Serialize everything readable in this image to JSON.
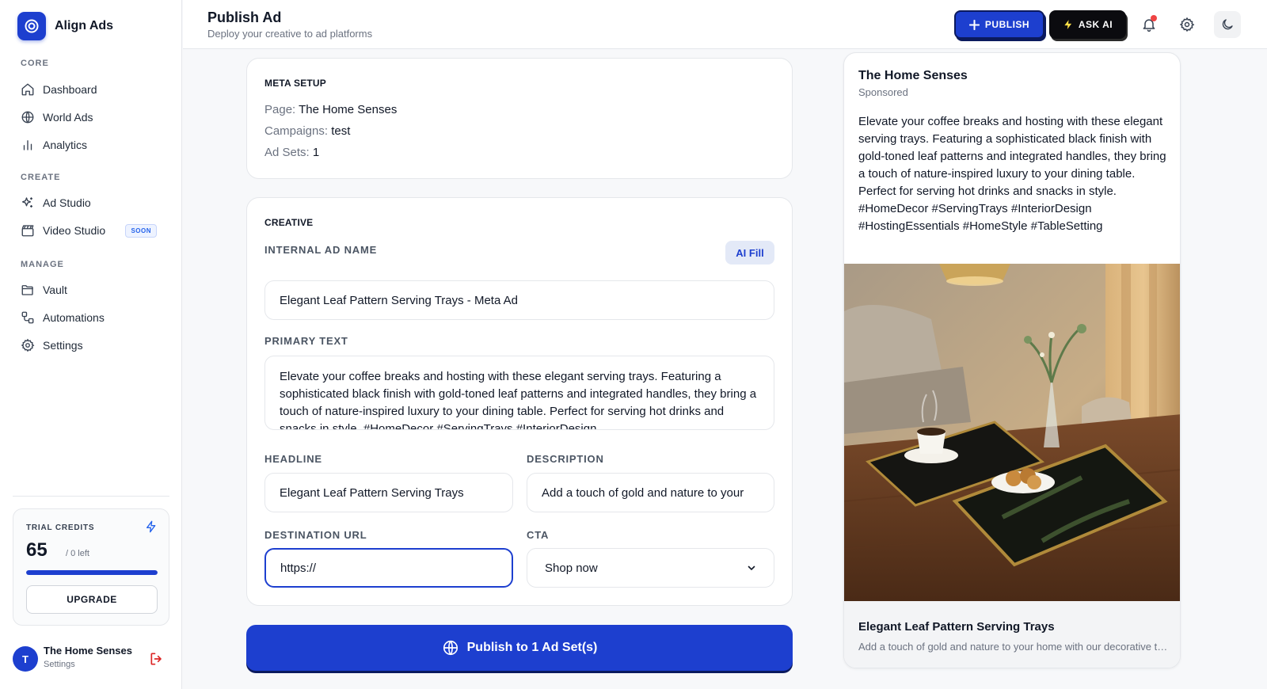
{
  "brand": {
    "name": "Align Ads"
  },
  "sidebar": {
    "sections": [
      {
        "label": "CORE"
      },
      {
        "label": "CREATE"
      },
      {
        "label": "MANAGE"
      }
    ],
    "items": [
      {
        "label": "Dashboard",
        "icon": "home-icon"
      },
      {
        "label": "World Ads",
        "icon": "globe-icon"
      },
      {
        "label": "Analytics",
        "icon": "bar-chart-icon"
      },
      {
        "label": "Ad Studio",
        "icon": "sparkles-icon"
      },
      {
        "label": "Video Studio",
        "icon": "clapperboard-icon",
        "badge": "SOON"
      },
      {
        "label": "Vault",
        "icon": "folder-icon"
      },
      {
        "label": "Automations",
        "icon": "workflow-icon"
      },
      {
        "label": "Settings",
        "icon": "gear-icon"
      }
    ]
  },
  "credits": {
    "label": "TRIAL CREDITS",
    "value": "65",
    "suffix": "/ 0 left",
    "progress": 1.0,
    "upgrade_label": "UPGRADE"
  },
  "user": {
    "initial": "T",
    "name": "The Home Senses",
    "sub": "Settings"
  },
  "header": {
    "title": "Publish Ad",
    "subtitle": "Deploy your creative to ad platforms",
    "publish_label": "PUBLISH",
    "ask_ai_label": "ASK AI"
  },
  "meta_setup": {
    "title": "META SETUP",
    "page_label": "Page:",
    "page_value": "The Home Senses",
    "campaigns_label": "Campaigns:",
    "campaigns_value": "test",
    "adsets_label": "Ad Sets:",
    "adsets_value": "1"
  },
  "creative": {
    "title": "CREATIVE",
    "ad_name_label": "INTERNAL AD NAME",
    "ai_fill_label": "AI Fill",
    "ad_name_value": "Elegant Leaf Pattern Serving Trays - Meta Ad",
    "primary_text_label": "PRIMARY TEXT",
    "primary_text_value": "Elevate your coffee breaks and hosting with these elegant serving trays. Featuring a sophisticated black finish with gold-toned leaf patterns and integrated handles, they bring a touch of nature-inspired luxury to your dining table. Perfect for serving hot drinks and snacks in style. #HomeDecor #ServingTrays #InteriorDesign",
    "headline_label": "HEADLINE",
    "headline_value": "Elegant Leaf Pattern Serving Trays",
    "description_label": "DESCRIPTION",
    "description_value": "Add a touch of gold and nature to your",
    "url_label": "DESTINATION URL",
    "url_value": "https://",
    "cta_label": "CTA",
    "cta_value": "Shop now"
  },
  "publish_button": {
    "label": "Publish to 1 Ad Set(s)"
  },
  "preview": {
    "page_name": "The Home Senses",
    "sponsored": "Sponsored",
    "text": "Elevate your coffee breaks and hosting with these elegant serving trays. Featuring a sophisticated black finish with gold-toned leaf patterns and integrated handles, they bring a touch of nature-inspired luxury to your dining table. Perfect for serving hot drinks and snacks in style. #HomeDecor #ServingTrays #InteriorDesign #HostingEssentials #HomeStyle #TableSetting",
    "headline": "Elegant Leaf Pattern Serving Trays",
    "description": "Add a touch of gold and nature to your home with our decorative trays."
  },
  "colors": {
    "accent": "#1d3fcf",
    "ask_ai_bg": "#0b0b0f",
    "ask_ai_bolt": "#fde047",
    "notification": "#ef4444"
  }
}
